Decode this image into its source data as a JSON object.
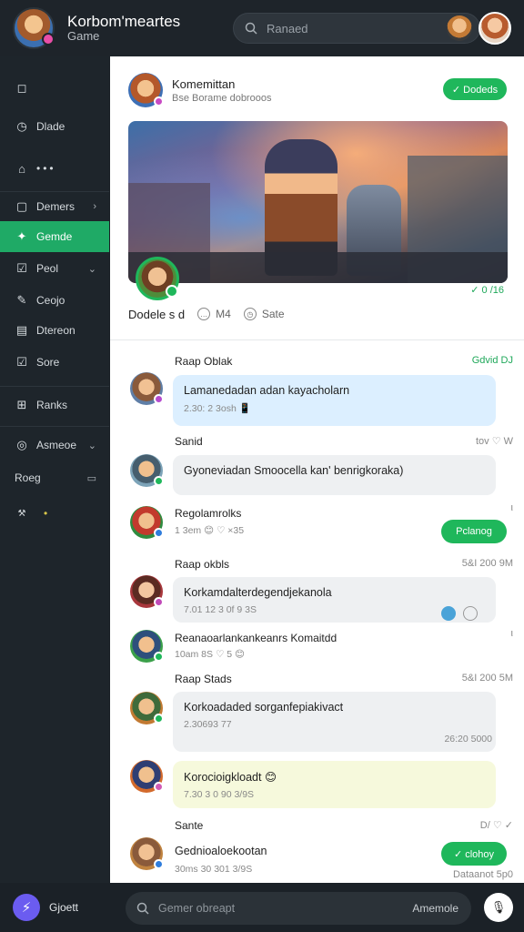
{
  "header": {
    "title": "Korbom'meartes",
    "subtitle": "Game",
    "search_placeholder": "Ranaed"
  },
  "sidebar": {
    "items": [
      {
        "icon": "square-icon",
        "label": ""
      },
      {
        "icon": "clock-icon",
        "label": "Dlade"
      },
      {
        "icon": "home-icon",
        "label": "•••"
      },
      {
        "icon": "square-icon",
        "label": "Demers"
      },
      {
        "icon": "game-icon",
        "label": "Gemde"
      },
      {
        "icon": "checkbox-icon",
        "label": "Peol"
      },
      {
        "icon": "edit-icon",
        "label": "Ceojo"
      },
      {
        "icon": "book-icon",
        "label": "Dtereon"
      },
      {
        "icon": "checkbox-icon",
        "label": "Sore"
      },
      {
        "icon": "grid-icon",
        "label": "Ranks"
      },
      {
        "icon": "circle-icon",
        "label": "Asmeoe"
      },
      {
        "icon": "folder-icon",
        "label": "Roeg"
      },
      {
        "icon": "tools-icon",
        "label": ""
      }
    ]
  },
  "post": {
    "author": "Komemittan",
    "subtitle": "Bse Borame dobrooos",
    "follow_label": "✓ Dodeds",
    "meta_label": "Dodele s d",
    "action1": "M4",
    "action2": "Sate",
    "right_label": "✓ 0 /16"
  },
  "messages": [
    {
      "name": "Raap Oblak",
      "right": "Gdvid   DJ",
      "text": "Lamanedadan adan kayacholarn",
      "sub": "2.30: 2 3osh 📱"
    },
    {
      "name": "Sanid",
      "right": "tov   ♡   W",
      "text": "Gyoneviadan Smoocella kan' benrigkoraka)",
      "sub": ""
    },
    {
      "name": "Regolamrolks",
      "right": "ι",
      "text": "",
      "sub": "1 3em 😊 ♡ ×35",
      "button": "Pclanog"
    },
    {
      "name": "Raap okbls",
      "right": "5&I 200 9M",
      "text": "Korkamdalterdegendjekanola",
      "sub": "7.01 12 3 0f 9 3S"
    },
    {
      "name": "Reanaoarlankankeanrs Komaitdd",
      "right": "ι",
      "text": "",
      "sub": "10am 8S ♡ 5 😊"
    },
    {
      "name": "Raap Stads",
      "right": "5&I 200 5M",
      "text": "Korkoadaded sorganfepiakivact",
      "sub": "2.30693 77",
      "corner": "26:20 5000"
    },
    {
      "name": "",
      "right": "",
      "text": "Korocioigkloadt 😊",
      "sub": "7.30 3 0 90 3/9S"
    },
    {
      "name": "Sante",
      "right": "D/   ♡   ✓",
      "text": "Gednioaloekootan",
      "sub": "30ms 30 301 3/9S",
      "button": "✓ clohoy",
      "corner": "Dataanot 5p0"
    }
  ],
  "bottom": {
    "left_label": "Gjoett",
    "composer_placeholder": "Gemer obreapt",
    "composer_right": "Amemole"
  },
  "colors": {
    "accent": "#1fb75b",
    "sidebar_bg": "#1e252b",
    "active_item": "#1faa66"
  }
}
